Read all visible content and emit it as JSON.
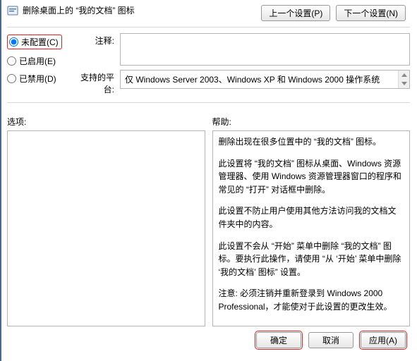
{
  "title": "删除桌面上的 “我的文档” 图标",
  "nav": {
    "prev": "上一个设置(P)",
    "next": "下一个设置(N)"
  },
  "radios": {
    "not_configured": "未配置(C)",
    "enabled": "已启用(E)",
    "disabled": "已禁用(D)",
    "selected": "not_configured"
  },
  "comment": {
    "label": "注释:",
    "value": ""
  },
  "supported": {
    "label": "支持的平台:",
    "value": "仅 Windows Server 2003、Windows XP 和 Windows 2000 操作系统"
  },
  "options": {
    "label": "选项:",
    "content": ""
  },
  "help": {
    "label": "帮助:",
    "paragraphs": [
      "删除出现在很多位置中的 “我的文档” 图标。",
      "此设置将 “我的文档” 图标从桌面、Windows 资源管理器、使用 Windows 资源管理器窗口的程序和常见的 “打开” 对话框中删除。",
      "此设置不防止用户使用其他方法访问我的文档文件夹中的内容。",
      "此设置不会从 “开始” 菜单中删除 “我的文档” 图标。要执行此操作，请使用 “从 ‘开始’ 菜单中删除 ‘我的文档’ 图标” 设置。",
      "注意: 必须注销并重新登录到 Windows 2000 Professional，才能使对于此设置的更改生效。"
    ]
  },
  "footer": {
    "ok": "确定",
    "cancel": "取消",
    "apply": "应用(A)"
  }
}
